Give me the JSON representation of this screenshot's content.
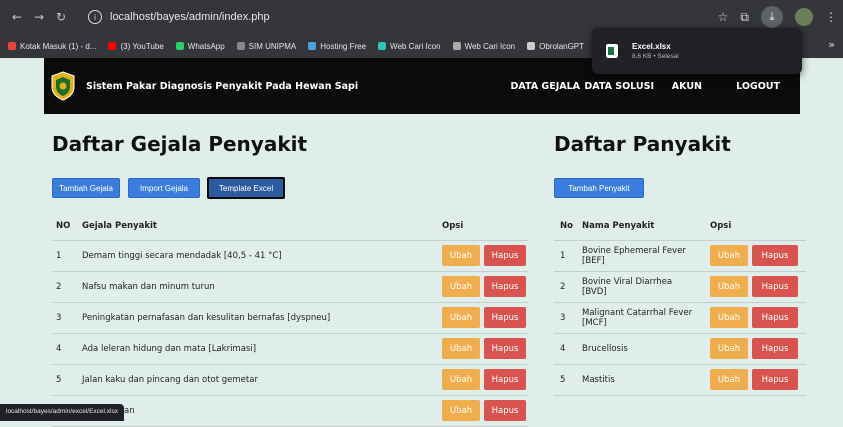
{
  "browser": {
    "url": "localhost/bayes/admin/index.php",
    "bookmarks": [
      {
        "label": "Kotak Masuk (1) - d...",
        "color": "#ea4335"
      },
      {
        "label": "(3) YouTube",
        "color": "#ff0000"
      },
      {
        "label": "WhatsApp",
        "color": "#25d366"
      },
      {
        "label": "SIM UNIPMA",
        "color": "#888888"
      },
      {
        "label": "Hosting Free",
        "color": "#4aa3df"
      },
      {
        "label": "Web Cari Icon",
        "color": "#2ec4b6"
      },
      {
        "label": "Web Cari Icon",
        "color": "#aaaaaa"
      },
      {
        "label": "ObrolanGPT",
        "color": "#cccccc"
      }
    ],
    "download": {
      "filename": "Excel.xlsx",
      "meta": "8,6 KB • Selesai"
    },
    "status_url": "localhost/bayes/admin/excel/Excel.xlsx"
  },
  "navbar": {
    "title": "Sistem Pakar Diagnosis Penyakit Pada Hewan Sapi",
    "links": [
      "DATA GEJALA",
      "DATA SOLUSI",
      "AKUN",
      "LOGOUT"
    ]
  },
  "gejala": {
    "heading": "Daftar Gejala Penyakit",
    "buttons": [
      "Tambah Gejala",
      "Import Gejala",
      "Template Excel"
    ],
    "columns": [
      "NO",
      "Gejala Penyakit",
      "Opsi"
    ],
    "rows": [
      {
        "no": "1",
        "name": "Demam tinggi secara mendadak [40,5 - 41 °C]"
      },
      {
        "no": "2",
        "name": "Nafsu makan dan minum turun"
      },
      {
        "no": "3",
        "name": "Peningkatan pernafasan dan kesulitan bernafas [dyspneu]"
      },
      {
        "no": "4",
        "name": "Ada leleran hidung dan mata [Lakrimasi]"
      },
      {
        "no": "5",
        "name": "Jalan kaku dan pincang dan otot gemetar"
      },
      {
        "no": "",
        "name": "kelumpuhan"
      }
    ]
  },
  "penyakit": {
    "heading": "Daftar Panyakit",
    "button": "Tambah Penyakit",
    "columns": [
      "No",
      "Nama Penyakit",
      "Opsi"
    ],
    "rows": [
      {
        "no": "1",
        "name": "Bovine Ephemeral Fever [BEF]"
      },
      {
        "no": "2",
        "name": "Bovine Viral Diarrhea [BVD]"
      },
      {
        "no": "3",
        "name": "Malignant Catarrhal Fever [MCF]"
      },
      {
        "no": "4",
        "name": "Brucellosis"
      },
      {
        "no": "5",
        "name": "Mastitis"
      }
    ]
  },
  "actions": {
    "edit": "Ubah",
    "delete": "Hapus"
  },
  "colors": {
    "primary": "#3b7ddd",
    "warning": "#f0ad4e",
    "danger": "#d9534f",
    "page_bg": "#dfeeea"
  }
}
